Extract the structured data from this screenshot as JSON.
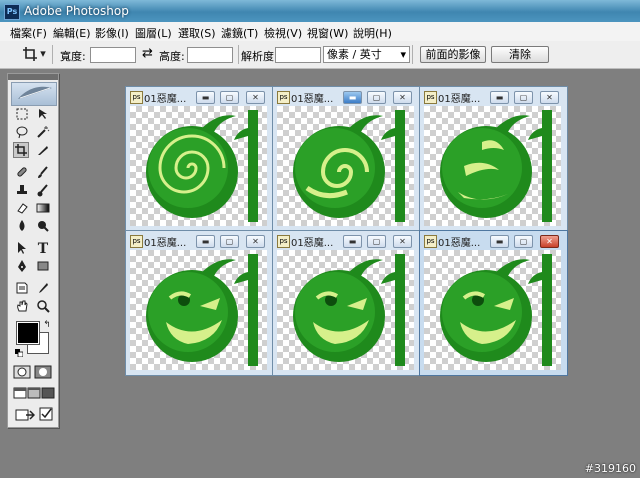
{
  "app": {
    "title": "Adobe Photoshop",
    "icon_text": "Ps"
  },
  "menubar": {
    "items": [
      "檔案(F)",
      "編輯(E)",
      "影像(I)",
      "圖層(L)",
      "選取(S)",
      "濾鏡(T)",
      "檢視(V)",
      "視窗(W)",
      "說明(H)"
    ]
  },
  "options": {
    "width_label": "寬度:",
    "swap_icon": "⇄",
    "height_label": "高度:",
    "resolution_label": "解析度:",
    "unit_select": "像素 / 英寸",
    "front_image_button": "前面的影像",
    "clear_button": "清除"
  },
  "toolbox": {
    "tools": [
      "marquee-icon",
      "move-icon",
      "lasso-icon",
      "magic-wand-icon",
      "crop-icon",
      "slice-icon",
      "healing-icon",
      "brush-icon",
      "stamp-icon",
      "history-brush-icon",
      "eraser-icon",
      "gradient-icon",
      "blur-icon",
      "dodge-icon",
      "path-select-icon",
      "type-icon",
      "pen-icon",
      "shape-icon",
      "notes-icon",
      "eyedropper-icon",
      "hand-icon",
      "zoom-icon"
    ],
    "foreground_color": "#000000",
    "background_color": "#ffffff"
  },
  "documents": [
    {
      "name": "01惡魔...",
      "frame": 1
    },
    {
      "name": "01惡魔...",
      "frame": 2
    },
    {
      "name": "01惡魔...",
      "frame": 3
    },
    {
      "name": "01惡魔...",
      "frame": 4
    },
    {
      "name": "01惡魔...",
      "frame": 5
    },
    {
      "name": "01惡魔...",
      "frame": 6
    }
  ],
  "window_buttons": {
    "minimize": "▬",
    "maximize": "▢",
    "close": "✕"
  },
  "watermark": "#319160",
  "colors": {
    "accent": "#3f86b0",
    "shape_green": "#1f8a1c",
    "light_green": "#d6f08b"
  }
}
